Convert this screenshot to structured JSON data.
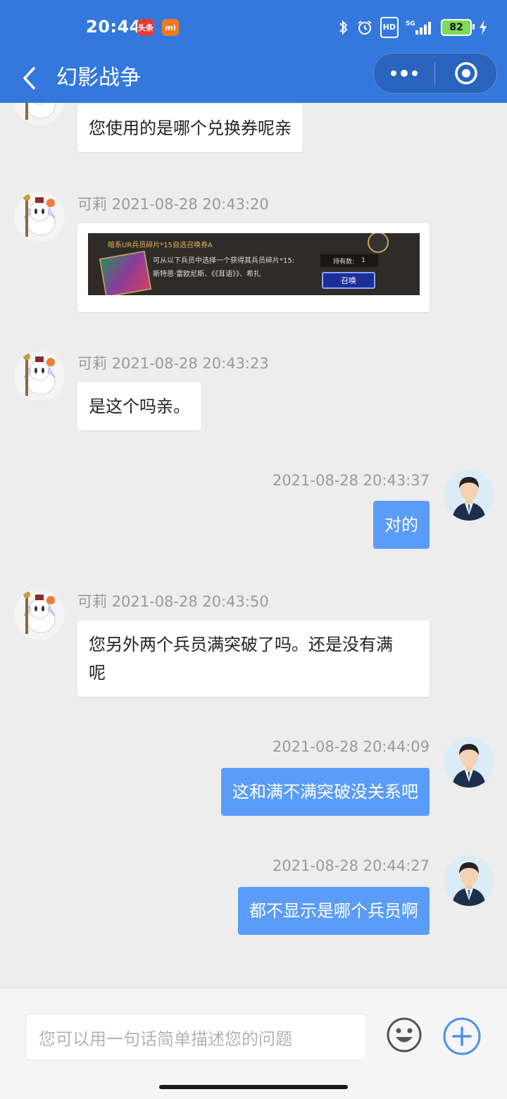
{
  "status_bar": {
    "time": "20:44",
    "app_badges": [
      "头条",
      "mi"
    ],
    "network": "5G",
    "hd": "HD",
    "battery": "82"
  },
  "nav": {
    "title": "幻影战争"
  },
  "messages": [
    {
      "side": "left",
      "author": "",
      "time": "",
      "text": "您使用的是哪个兑换券呢亲"
    },
    {
      "side": "left",
      "author": "可莉",
      "time": "2021-08-28 20:43:20",
      "type": "image",
      "image": {
        "title": "暗系UR兵员碎片*15自选召唤券A",
        "desc_line1": "可从以下兵员中选择一个获得其兵员碎片*15:",
        "desc_line2": "斯特恩·雷欧尼斯、《《耳语》》、希扎",
        "count_label": "持有数:",
        "count_value": "1",
        "button": "召唤"
      }
    },
    {
      "side": "left",
      "author": "可莉",
      "time": "2021-08-28 20:43:23",
      "text": "是这个吗亲。"
    },
    {
      "side": "right",
      "time": "2021-08-28 20:43:37",
      "text": "对的"
    },
    {
      "side": "left",
      "author": "可莉",
      "time": "2021-08-28 20:43:50",
      "text_line1": "您另外两个兵员满突破了吗。还是没有满",
      "text_line2": "呢"
    },
    {
      "side": "right",
      "time": "2021-08-28 20:44:09",
      "text": "这和满不满突破没关系吧"
    },
    {
      "side": "right",
      "time": "2021-08-28 20:44:27",
      "text": "都不显示是哪个兵员啊"
    }
  ],
  "input": {
    "placeholder": "您可以用一句话简单描述您的问题"
  },
  "colors": {
    "header_blue": "#3478de",
    "outgoing_bubble": "#5b9cf8",
    "background": "#ededed"
  },
  "icons": [
    "back-arrow-icon",
    "more-dots-icon",
    "close-circle-icon",
    "emoji-icon",
    "plus-icon",
    "bluetooth-icon",
    "alarm-icon",
    "signal-icon",
    "charging-icon"
  ]
}
